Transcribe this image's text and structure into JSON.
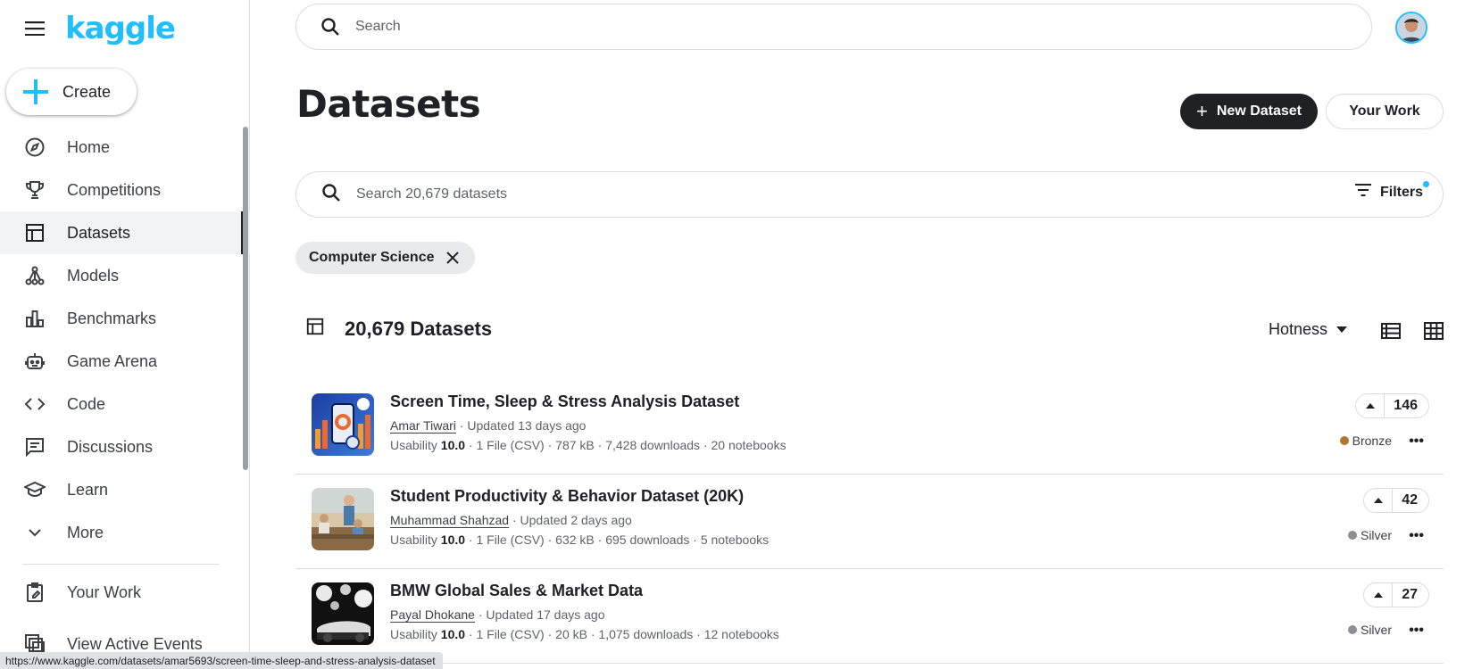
{
  "app": {
    "logo_text": "kaggle",
    "accent": "#20beff"
  },
  "sidebar": {
    "create_label": "Create",
    "items": [
      {
        "label": "Home",
        "icon": "compass-icon"
      },
      {
        "label": "Competitions",
        "icon": "trophy-icon"
      },
      {
        "label": "Datasets",
        "icon": "table-icon",
        "active": true
      },
      {
        "label": "Models",
        "icon": "models-icon"
      },
      {
        "label": "Benchmarks",
        "icon": "bar-chart-icon"
      },
      {
        "label": "Game Arena",
        "icon": "robot-icon"
      },
      {
        "label": "Code",
        "icon": "code-icon"
      },
      {
        "label": "Discussions",
        "icon": "discussion-icon"
      },
      {
        "label": "Learn",
        "icon": "graduation-cap-icon"
      },
      {
        "label": "More",
        "icon": "chevron-down-icon"
      }
    ],
    "secondary": [
      {
        "label": "Your Work",
        "icon": "clipboard-icon"
      },
      {
        "label": "View Active Events",
        "icon": "events-icon"
      }
    ]
  },
  "search": {
    "placeholder": "Search"
  },
  "header": {
    "title": "Datasets",
    "new_dataset_label": "New Dataset",
    "your_work_label": "Your Work"
  },
  "dataset_search": {
    "placeholder": "Search 20,679 datasets",
    "filters_label": "Filters"
  },
  "chip": {
    "label": "Computer Science"
  },
  "results": {
    "count_label": "20,679 Datasets",
    "sort_label": "Hotness"
  },
  "datasets": [
    {
      "title": "Screen Time, Sleep & Stress Analysis Dataset",
      "author": "Amar Tiwari",
      "updated": " · Updated 13 days ago",
      "usability_label": "Usability ",
      "usability": "10.0",
      "stats": " · 1 File (CSV) · 787 kB · 7,428 downloads · 20 notebooks",
      "votes": "146",
      "medal": "Bronze",
      "medal_color": "#b87333"
    },
    {
      "title": "Student Productivity & Behavior Dataset (20K)",
      "author": "Muhammad Shahzad",
      "updated": " · Updated 2 days ago",
      "usability_label": "Usability ",
      "usability": "10.0",
      "stats": " · 1 File (CSV) · 632 kB · 695 downloads · 5 notebooks",
      "votes": "42",
      "medal": "Silver",
      "medal_color": "#8a8f94"
    },
    {
      "title": "BMW Global Sales & Market Data",
      "author": "Payal Dhokane",
      "updated": " · Updated 17 days ago",
      "usability_label": "Usability ",
      "usability": "10.0",
      "stats": " · 1 File (CSV) · 20 kB · 1,075 downloads · 12 notebooks",
      "votes": "27",
      "medal": "Silver",
      "medal_color": "#8a8f94"
    }
  ],
  "status_url": "https://www.kaggle.com/datasets/amar5693/screen-time-sleep-and-stress-analysis-dataset"
}
